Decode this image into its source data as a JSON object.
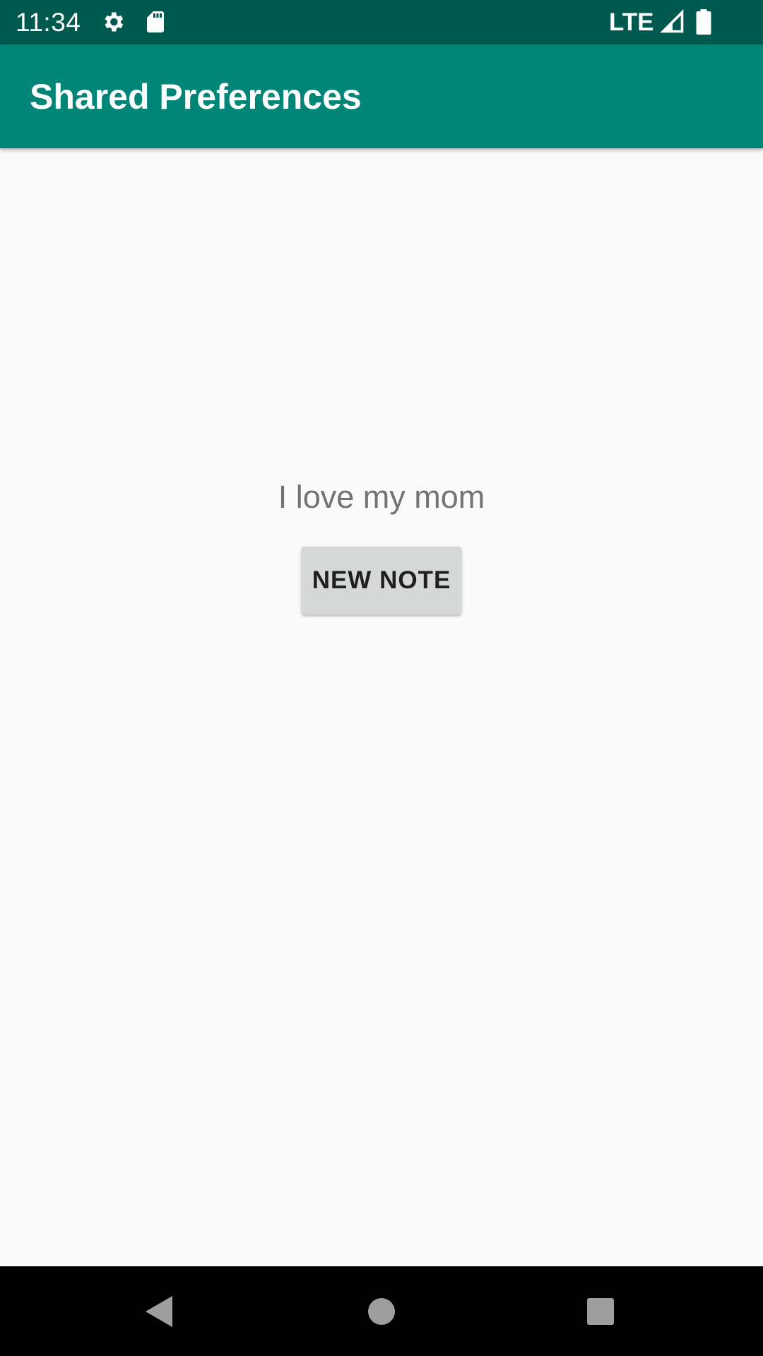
{
  "status_bar": {
    "time": "11:34",
    "network": "LTE",
    "icons": [
      "gear-icon",
      "sd-card-icon",
      "signal-icon",
      "battery-icon"
    ]
  },
  "app_bar": {
    "title": "Shared Preferences",
    "color": "#008577"
  },
  "main": {
    "note_text": "I love my mom",
    "new_note_button": "NEW NOTE"
  },
  "nav_bar": {
    "icons": [
      "back-icon",
      "home-icon",
      "recents-icon"
    ]
  }
}
